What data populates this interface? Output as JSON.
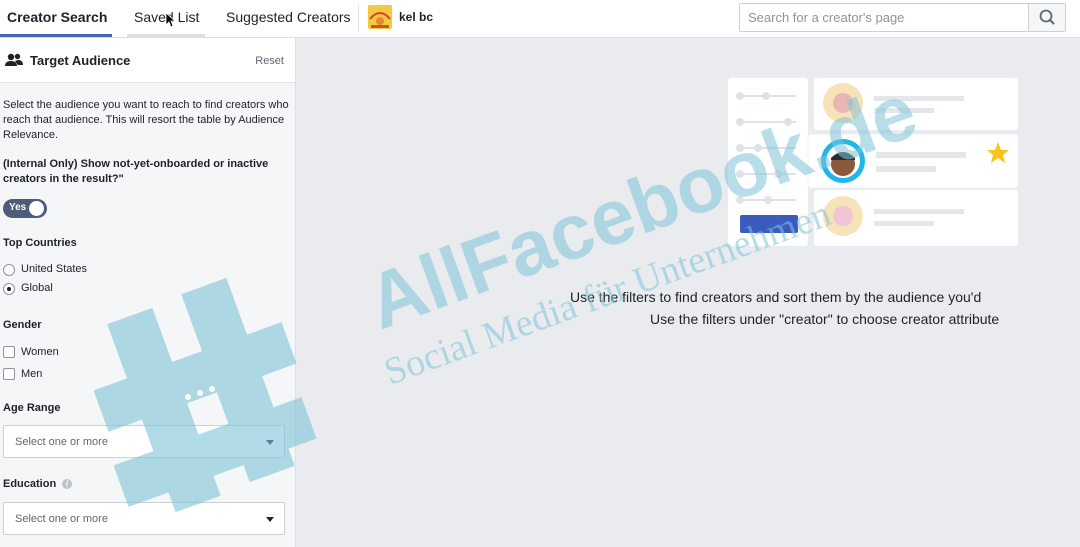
{
  "topbar": {
    "tabs": [
      {
        "label": "Creator Search",
        "active": true
      },
      {
        "label": "Saved List",
        "active": false
      },
      {
        "label": "Suggested Creators",
        "active": false
      }
    ],
    "user_name": "kel bc",
    "search_placeholder": "Search for a creator's page",
    "search_icon": "magnifier-icon"
  },
  "sidebar": {
    "title": "Target Audience",
    "reset_label": "Reset",
    "description": "Select the audience you want to reach to find creators who reach that audience. This will resort the table by Audience Relevance.",
    "internal_question": "(Internal Only) Show not-yet-onboarded or inactive creators in the result?\"",
    "toggle_label": "Yes",
    "top_countries": {
      "title": "Top Countries",
      "options": [
        {
          "label": "United States",
          "selected": false
        },
        {
          "label": "Global",
          "selected": true
        }
      ]
    },
    "gender": {
      "title": "Gender",
      "options": [
        {
          "label": "Women",
          "checked": false
        },
        {
          "label": "Men",
          "checked": false
        }
      ]
    },
    "age_range": {
      "title": "Age Range",
      "placeholder": "Select one or more"
    },
    "education": {
      "title": "Education",
      "placeholder": "Select one or more"
    }
  },
  "main": {
    "message_line1": "Use the filters to find creators and sort them by the audience you'd",
    "message_line2": "Use the filters under \"creator\" to choose creator attribute"
  },
  "watermark": {
    "brand": "AllFacebook.de",
    "tagline": "Social Media für Unternehmen"
  },
  "colors": {
    "accent": "#4267b2",
    "toggle": "#4b5d79",
    "watermark": "#7fc4d9",
    "star": "#f5c518",
    "highlight": "#1fb6e8"
  }
}
